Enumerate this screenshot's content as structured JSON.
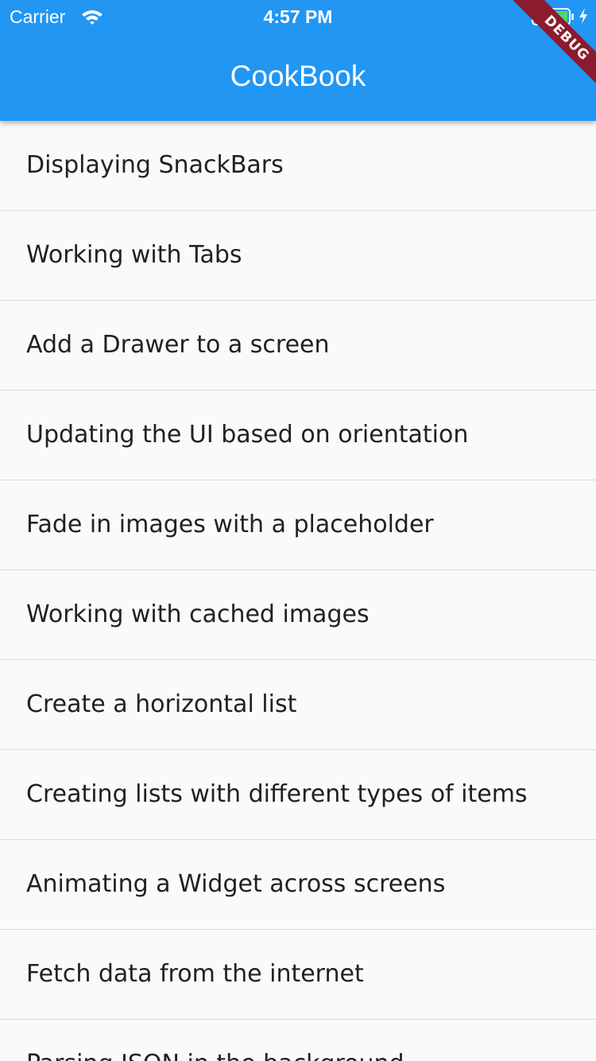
{
  "status_bar": {
    "carrier": "Carrier",
    "time": "4:57 PM",
    "icons": [
      "wifi-icon",
      "battery-icon",
      "charging-icon"
    ]
  },
  "app_bar": {
    "title": "CookBook",
    "debug_banner": "DEBUG"
  },
  "recipes": [
    "Displaying SnackBars",
    "Working with Tabs",
    "Add a Drawer to a screen",
    "Updating the UI based on orientation",
    "Fade in images with a placeholder",
    "Working with cached images",
    "Create a horizontal list",
    "Creating lists with different types of items",
    "Animating a Widget across screens",
    "Fetch data from the internet",
    "Parsing JSON in the background"
  ],
  "colors": {
    "primary": "#2196f3",
    "background": "#fafafa",
    "divider": "#dcdcdc",
    "text": "#212121",
    "battery_fill": "#4cd964",
    "debug_banner": "#8b1c2f"
  }
}
